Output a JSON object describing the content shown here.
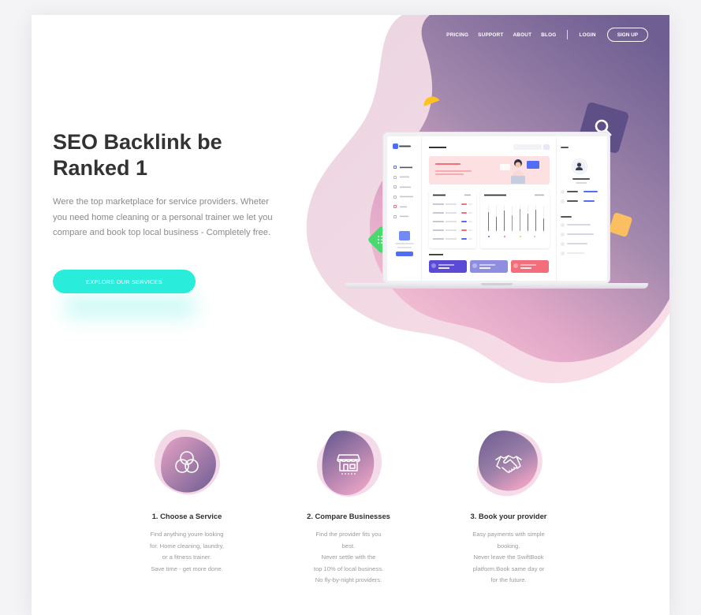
{
  "nav": {
    "links": [
      "PRICING",
      "SUPPORT",
      "ABOUT",
      "BLOG"
    ],
    "login": "LOGIN",
    "signup": "SIGN UP"
  },
  "hero": {
    "title_line1": "SEO Backlink be",
    "title_line2": "Ranked 1",
    "description": "Were the top marketplace for service providers. Wheter you need home cleaning or a personal trainer we let you compare and book top local business - Completely free.",
    "cta": "EXPLORE OUR SERVICES"
  },
  "features": [
    {
      "icon": "venn-circles-icon",
      "title": "1. Choose a Service",
      "lines": [
        "Find anything youre looking",
        "for. Home cleaning, laundry,",
        "or a fitness trainer.",
        "Save time - get more done."
      ]
    },
    {
      "icon": "storefront-icon",
      "title": "2. Compare Businesses",
      "lines": [
        "Find the provider fits you",
        "best.",
        "Never settle with the",
        "top 10% of local business.",
        "No fly-by-night providers."
      ]
    },
    {
      "icon": "handshake-icon",
      "title": "3. Book your provider",
      "lines": [
        "Easy payments with simple",
        "booking.",
        "Never leave the SwiftBook",
        "platform.Book same day or",
        "for the future."
      ]
    }
  ],
  "colors": {
    "accent": "#29ecdb",
    "blob_purple": "#7b6a9c",
    "blob_pink": "#f2b4cc",
    "heading": "#333335",
    "body_text": "#8a8a8e"
  }
}
